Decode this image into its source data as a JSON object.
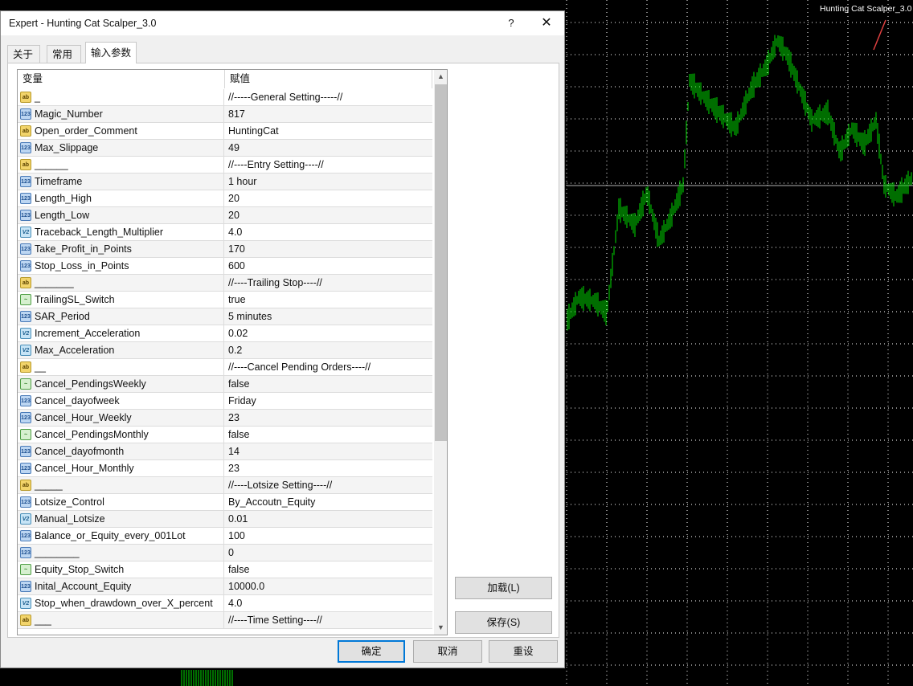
{
  "chart": {
    "indicator_label": "Hunting Cat Scalper_3.0 ☺",
    "colors": {
      "background": "#000000",
      "grid": "#ffffff",
      "candles": "#00dd00",
      "price_line": "#b0b0b0"
    }
  },
  "dialog": {
    "title": "Expert - Hunting Cat Scalper_3.0",
    "help_label": "?",
    "close_label": "✕",
    "tabs": [
      {
        "label": "关于",
        "active": false
      },
      {
        "label": "常用",
        "active": false
      },
      {
        "label": "输入参数",
        "active": true
      }
    ],
    "columns": {
      "variable": "变量",
      "value": "赋值"
    },
    "rows": [
      {
        "icon": "ab",
        "name": "_",
        "value": "//-----General Setting-----//"
      },
      {
        "icon": "num",
        "name": "Magic_Number",
        "value": "817"
      },
      {
        "icon": "ab",
        "name": "Open_order_Comment",
        "value": "HuntingCat"
      },
      {
        "icon": "num",
        "name": "Max_Slippage",
        "value": "49"
      },
      {
        "icon": "ab",
        "name": "______",
        "value": "//----Entry Setting----//"
      },
      {
        "icon": "num",
        "name": "Timeframe",
        "value": "1 hour"
      },
      {
        "icon": "num",
        "name": "Length_High",
        "value": "20"
      },
      {
        "icon": "num",
        "name": "Length_Low",
        "value": "20"
      },
      {
        "icon": "dec",
        "name": "Traceback_Length_Multiplier",
        "value": "4.0"
      },
      {
        "icon": "num",
        "name": "Take_Profit_in_Points",
        "value": "170"
      },
      {
        "icon": "num",
        "name": "Stop_Loss_in_Points",
        "value": "600"
      },
      {
        "icon": "ab",
        "name": "_______",
        "value": "//----Trailing Stop----//"
      },
      {
        "icon": "bool",
        "name": "TrailingSL_Switch",
        "value": "true"
      },
      {
        "icon": "num",
        "name": "SAR_Period",
        "value": "5 minutes"
      },
      {
        "icon": "dec",
        "name": "Increment_Acceleration",
        "value": "0.02"
      },
      {
        "icon": "dec",
        "name": "Max_Acceleration",
        "value": "0.2"
      },
      {
        "icon": "ab",
        "name": "__",
        "value": "//----Cancel Pending Orders----//"
      },
      {
        "icon": "bool",
        "name": "Cancel_PendingsWeekly",
        "value": "false"
      },
      {
        "icon": "num",
        "name": "Cancel_dayofweek",
        "value": "Friday"
      },
      {
        "icon": "num",
        "name": "Cancel_Hour_Weekly",
        "value": "23"
      },
      {
        "icon": "bool",
        "name": "Cancel_PendingsMonthly",
        "value": "false"
      },
      {
        "icon": "num",
        "name": "Cancel_dayofmonth",
        "value": "14"
      },
      {
        "icon": "num",
        "name": "Cancel_Hour_Monthly",
        "value": "23"
      },
      {
        "icon": "ab",
        "name": "_____",
        "value": "//----Lotsize Setting----//"
      },
      {
        "icon": "num",
        "name": "Lotsize_Control",
        "value": "By_Accoutn_Equity"
      },
      {
        "icon": "dec",
        "name": "Manual_Lotsize",
        "value": "0.01"
      },
      {
        "icon": "num",
        "name": "Balance_or_Equity_every_001Lot",
        "value": "100"
      },
      {
        "icon": "num",
        "name": "________",
        "value": "0"
      },
      {
        "icon": "bool",
        "name": "Equity_Stop_Switch",
        "value": "false"
      },
      {
        "icon": "num",
        "name": "Inital_Account_Equity",
        "value": "10000.0"
      },
      {
        "icon": "dec",
        "name": "Stop_when_drawdown_over_X_percent",
        "value": "4.0"
      },
      {
        "icon": "ab",
        "name": "___",
        "value": "//----Time Setting----//"
      }
    ],
    "buttons": {
      "load": "加载(L)",
      "save": "保存(S)",
      "ok": "确定",
      "cancel": "取消",
      "reset": "重设"
    }
  }
}
